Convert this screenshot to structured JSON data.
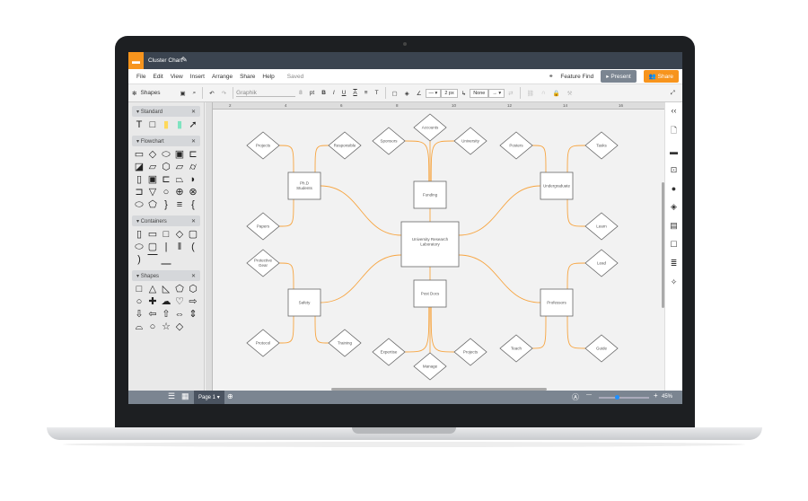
{
  "app": {
    "doc_title": "Cluster Chart",
    "saved_status": "Saved"
  },
  "menu": [
    "File",
    "Edit",
    "View",
    "Insert",
    "Arrange",
    "Share",
    "Help"
  ],
  "header_actions": {
    "feature_find": "Feature Find",
    "present": "Present",
    "share": "Share"
  },
  "toolbar": {
    "shapes_label": "Shapes",
    "font": "Graphik",
    "font_size": "8",
    "font_unit": "pt",
    "bold": "B",
    "italic": "I",
    "underline": "U",
    "font_color": "A",
    "line_width": "2 px",
    "arrow_start": "None"
  },
  "ruler": [
    "2",
    "4",
    "6",
    "8",
    "10",
    "12",
    "14",
    "16"
  ],
  "library": [
    {
      "title": "Standard",
      "shapes": [
        "T",
        "□",
        "▮",
        "▮",
        "➚"
      ]
    },
    {
      "title": "Flowchart",
      "shapes": [
        "▭",
        "◇",
        "⬭",
        "▣",
        "⊏",
        "◪",
        "▱",
        "⬡",
        "▱",
        "⌭",
        "▯",
        "▣",
        "⊏",
        "⏢",
        "◗",
        "⊐",
        "▽",
        "○",
        "⊕",
        "⊗",
        "⬭",
        "⬠",
        "}",
        "≡",
        "{"
      ]
    },
    {
      "title": "Containers",
      "shapes": [
        "▯",
        "▭",
        "□",
        "◇",
        "▢",
        "⬭",
        "▢",
        "|",
        "‖",
        "(",
        ")",
        "⎺",
        "⎽"
      ]
    },
    {
      "title": "Shapes",
      "shapes": [
        "□",
        "△",
        "◺",
        "⬠",
        "⬡",
        "○",
        "✚",
        "☁",
        "♡",
        "⇨",
        "⇩",
        "⇦",
        "⇧",
        "⇔",
        "⇕",
        "⌓",
        "○",
        "☆",
        "◇"
      ]
    }
  ],
  "diagram": {
    "center": "University Research Laboratory",
    "boxes": [
      "Ph.D Students",
      "Funding",
      "Undergraduate",
      "Safety",
      "Post Docs",
      "Professors"
    ],
    "leaves": {
      "phd": [
        "Projects",
        "Responsible",
        "Papers"
      ],
      "funding": [
        "Sponsors",
        "Accounts",
        "University"
      ],
      "undergrad": [
        "Posters",
        "Tasks",
        "Learn"
      ],
      "safety": [
        "Protective Gear",
        "Protocol",
        "Training"
      ],
      "postdocs": [
        "Expertise",
        "Manage",
        "Projects"
      ],
      "professors": [
        "Lead",
        "Guide",
        "Teach"
      ]
    },
    "edge_color": "#f7a541"
  },
  "bottom": {
    "page": "Page 1",
    "zoom": "45%",
    "zoom_fraction": 0.35
  },
  "colors": {
    "accent": "#f7941d",
    "titlebar": "#3b4450",
    "present": "#7b8591"
  }
}
